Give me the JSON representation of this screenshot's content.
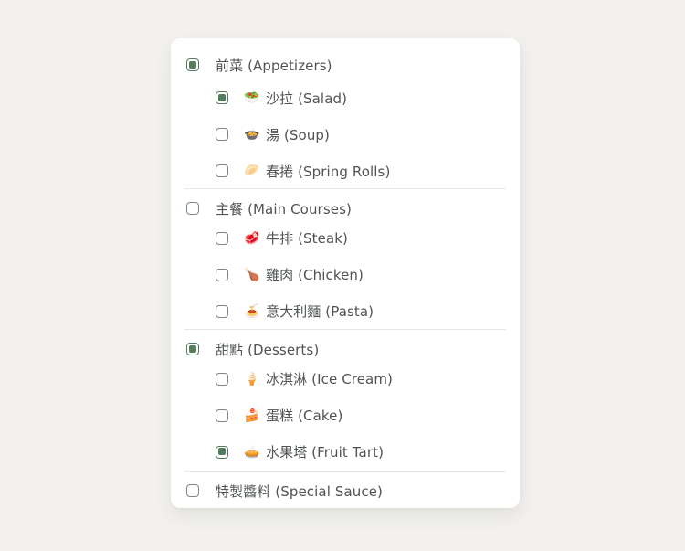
{
  "groups": [
    {
      "label": "前菜 (Appetizers)",
      "checked": true,
      "items": [
        {
          "icon": "salad-icon",
          "emoji": "🥗",
          "label": "沙拉 (Salad)",
          "checked": true
        },
        {
          "icon": "soup-icon",
          "emoji": "🍲",
          "label": "湯 (Soup)",
          "checked": false
        },
        {
          "icon": "spring-roll-icon",
          "emoji": "🥟",
          "label": "春捲 (Spring Rolls)",
          "checked": false
        }
      ]
    },
    {
      "label": "主餐 (Main Courses)",
      "checked": false,
      "items": [
        {
          "icon": "steak-icon",
          "emoji": "🥩",
          "label": "牛排 (Steak)",
          "checked": false
        },
        {
          "icon": "chicken-icon",
          "emoji": "🍗",
          "label": "雞肉 (Chicken)",
          "checked": false
        },
        {
          "icon": "pasta-icon",
          "emoji": "🍝",
          "label": "意大利麵 (Pasta)",
          "checked": false
        }
      ]
    },
    {
      "label": "甜點 (Desserts)",
      "checked": true,
      "items": [
        {
          "icon": "ice-cream-icon",
          "emoji": "🍦",
          "label": "冰淇淋 (Ice Cream)",
          "checked": false
        },
        {
          "icon": "cake-icon",
          "emoji": "🍰",
          "label": "蛋糕 (Cake)",
          "checked": false
        },
        {
          "icon": "fruit-tart-icon",
          "emoji": "🥧",
          "label": "水果塔 (Fruit Tart)",
          "checked": true
        }
      ]
    }
  ],
  "special": {
    "label": "特製醬料 (Special Sauce)",
    "checked": false
  },
  "colors": {
    "accent": "#567c5e",
    "background": "#f2f1ee",
    "card": "#ffffff",
    "text": "#4f5450"
  }
}
